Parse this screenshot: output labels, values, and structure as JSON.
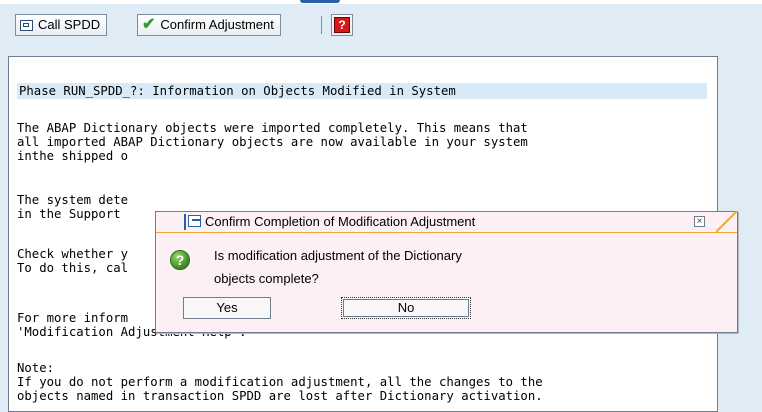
{
  "toolbar": {
    "call_spdd_label": "Call SPDD",
    "confirm_label": "Confirm Adjustment"
  },
  "document": {
    "header": "Phase RUN_SPDD_?: Information on Objects Modified in System",
    "lines": [
      "The ABAP Dictionary objects were imported completely. This means that",
      "all imported ABAP Dictionary objects are now available in your system",
      "inthe shipped o",
      "",
      "The system dete",
      "in the Support",
      "",
      "Check whether y",
      "To do this, cal",
      "",
      "For more inform",
      "'Modification Adjustment Help'.",
      "",
      "Note:",
      "If you do not perform a modification adjustment, all the changes to the",
      "objects named in transaction SPDD are lost after Dictionary activation."
    ]
  },
  "dialog": {
    "title": "Confirm Completion of Modification Adjustment",
    "question_line1": "Is modification adjustment of the Dictionary",
    "question_line2": "objects complete?",
    "yes_label": "Yes",
    "no_label": "No"
  },
  "icons": {
    "call": "call-transaction-icon",
    "check": "checkmark-icon",
    "help": "help-icon",
    "question": "question-icon",
    "close": "close-icon"
  },
  "colors": {
    "background": "#dfebf5",
    "header_highlight": "#d8eaf7",
    "dialog_bg": "#fcf0f4",
    "accent": "#f0a830"
  }
}
